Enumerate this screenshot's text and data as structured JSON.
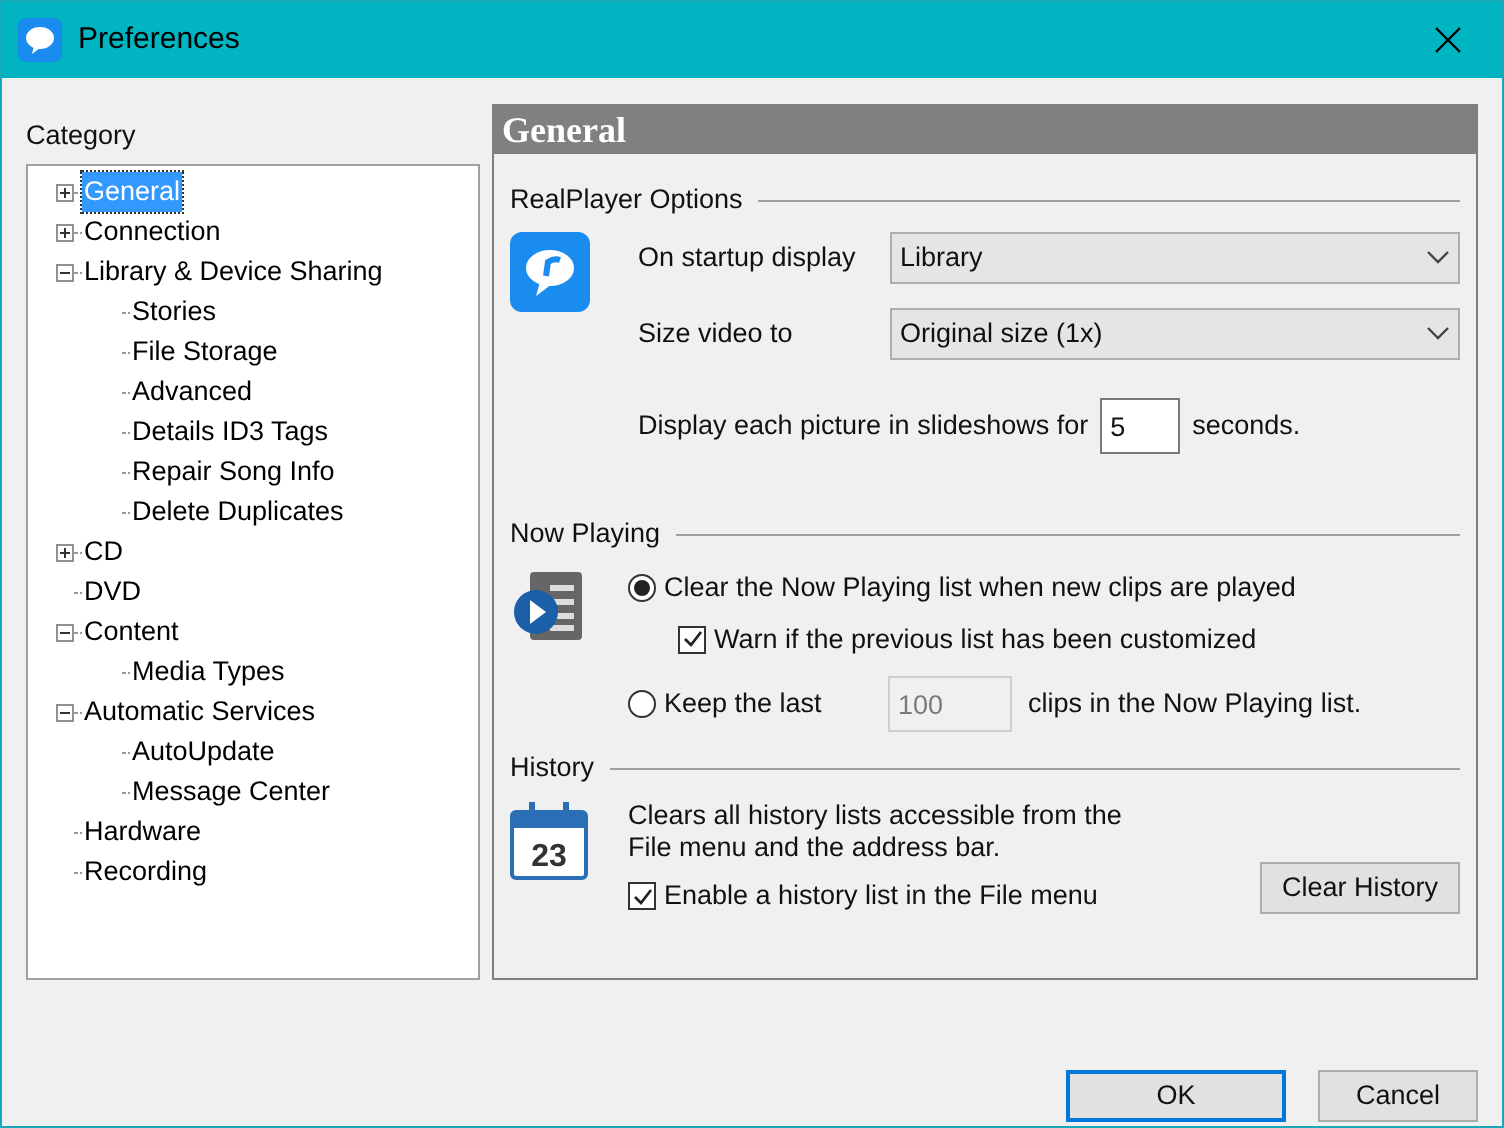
{
  "window": {
    "title": "Preferences"
  },
  "category_label": "Category",
  "tree": [
    {
      "kind": "node",
      "label": "General",
      "expanded": false,
      "selected": true
    },
    {
      "kind": "node",
      "label": "Connection",
      "expanded": false,
      "selected": false
    },
    {
      "kind": "node",
      "label": "Library & Device Sharing",
      "expanded": true,
      "selected": false,
      "children": [
        {
          "kind": "leaf",
          "label": "Stories",
          "selected": false
        },
        {
          "kind": "leaf",
          "label": "File Storage",
          "selected": false
        },
        {
          "kind": "leaf",
          "label": "Advanced",
          "selected": false
        },
        {
          "kind": "leaf",
          "label": "Details ID3 Tags",
          "selected": false
        },
        {
          "kind": "leaf",
          "label": "Repair Song Info",
          "selected": false
        },
        {
          "kind": "leaf",
          "label": "Delete Duplicates",
          "selected": false
        }
      ]
    },
    {
      "kind": "node",
      "label": "CD",
      "expanded": false,
      "selected": false
    },
    {
      "kind": "leaf",
      "label": "DVD",
      "selected": false
    },
    {
      "kind": "node",
      "label": "Content",
      "expanded": true,
      "selected": false,
      "children": [
        {
          "kind": "leaf",
          "label": "Media Types",
          "selected": false
        }
      ]
    },
    {
      "kind": "node",
      "label": "Automatic Services",
      "expanded": true,
      "selected": false,
      "children": [
        {
          "kind": "leaf",
          "label": "AutoUpdate",
          "selected": false
        },
        {
          "kind": "leaf",
          "label": "Message Center",
          "selected": false
        }
      ]
    },
    {
      "kind": "leaf",
      "label": "Hardware",
      "selected": false
    },
    {
      "kind": "leaf",
      "label": "Recording",
      "selected": false
    }
  ],
  "panel": {
    "title": "General",
    "realplayer_options": {
      "title": "RealPlayer Options",
      "startup": {
        "label": "On startup display",
        "value": "Library"
      },
      "size_video": {
        "label": "Size video to",
        "value": "Original size (1x)"
      },
      "slideshow": {
        "label_before": "Display each picture in slideshows for",
        "value": "5",
        "label_after": "seconds."
      }
    },
    "now_playing": {
      "title": "Now Playing",
      "clear_option": {
        "label": "Clear the Now Playing list when new clips are played",
        "selected": true
      },
      "warn_checkbox": {
        "label": "Warn if the previous list has been customized",
        "checked": true
      },
      "keep_option": {
        "label_before": "Keep the last",
        "value": "100",
        "label_after": "clips in the Now Playing list.",
        "selected": false,
        "disabled": true
      }
    },
    "history": {
      "title": "History",
      "calendar_day": "23",
      "description": "Clears all history lists accessible from the File menu and the address bar.",
      "checkbox": {
        "label": "Enable a history list in the File menu",
        "checked": true
      },
      "button": "Clear History"
    }
  },
  "buttons": [
    {
      "label": "OK",
      "default": true
    },
    {
      "label": "Cancel",
      "default": false
    }
  ]
}
